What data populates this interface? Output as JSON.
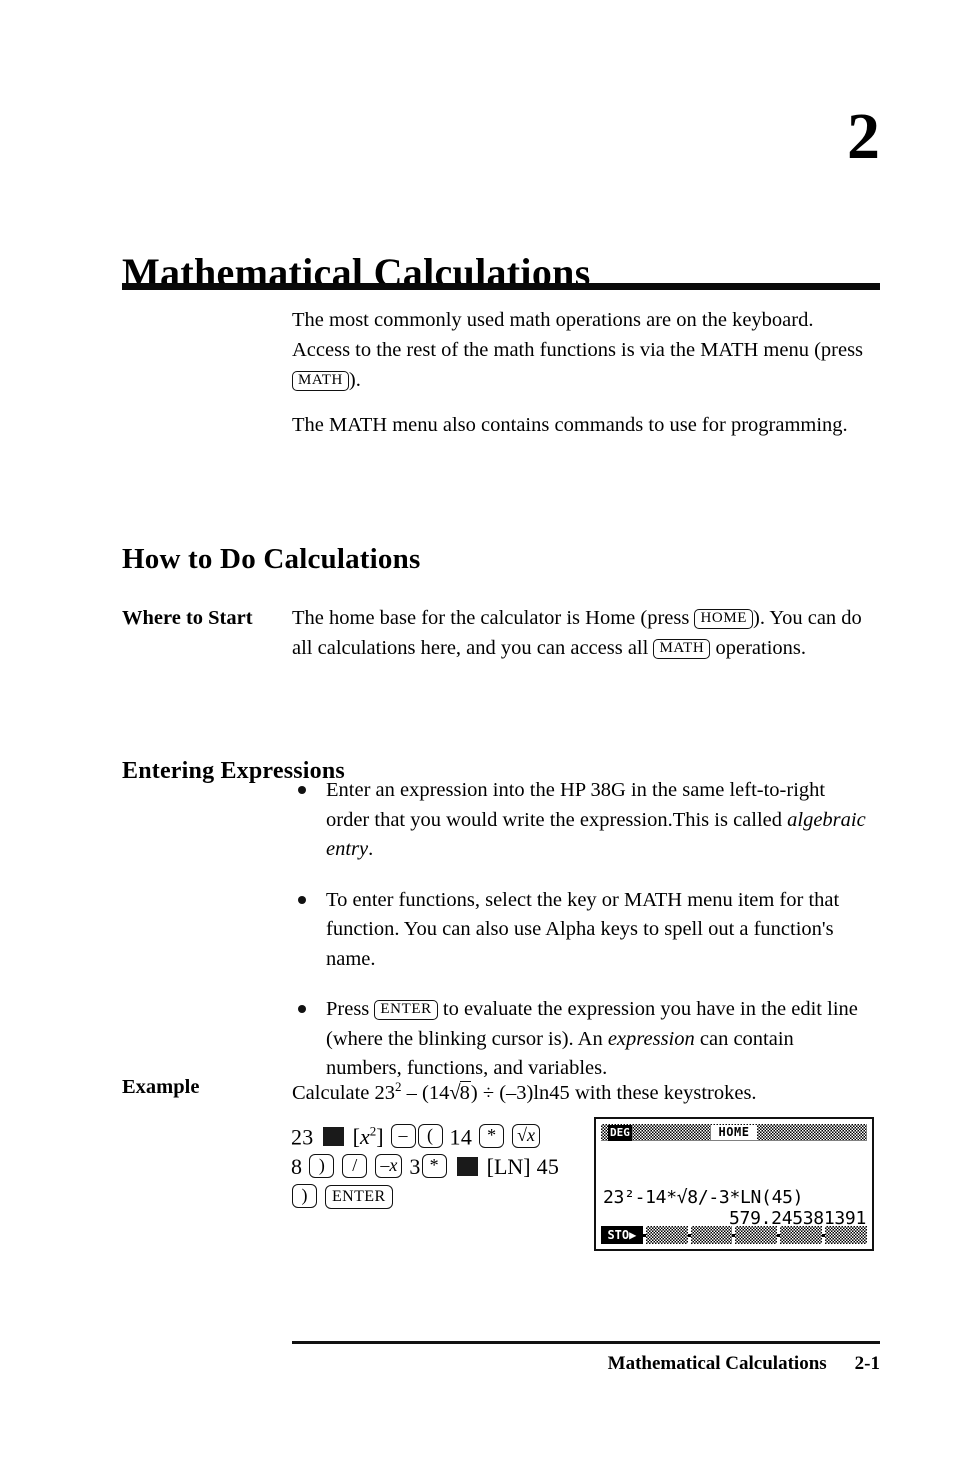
{
  "chapter": {
    "number": "2",
    "title": "Mathematical Calculations"
  },
  "intro": {
    "paragraph1_part1": "The most commonly used math operations are on the keyboard. Access to the rest of the math functions is via the MATH menu (press ",
    "paragraph1_key": "MATH",
    "paragraph1_part2": ").",
    "paragraph2": "The MATH menu also contains commands to use for programming."
  },
  "sections": {
    "how_to_do_calculations": "How to Do Calculations",
    "entering_expressions": "Entering Expressions"
  },
  "where_to_start": {
    "label": "Where to Start",
    "text_part1": "The home base for the calculator is Home (press ",
    "key_home": "HOME",
    "text_part2": "). You can do all calculations here, and you can access all ",
    "key_math": "MATH",
    "text_part3": " operations."
  },
  "bullets": [
    {
      "text_part1": "Enter an expression into the HP 38G in the same left-to-right order that you would write the expression.This is called ",
      "italic": "algebraic entry",
      "text_part2": "."
    },
    {
      "text_part1": "To enter functions, select the key or MATH menu item for that function. You can also use Alpha keys to spell out a function's name.",
      "italic": "",
      "text_part2": ""
    },
    {
      "text_part1": "Press ",
      "key": "ENTER",
      "text_part2": " to evaluate the expression you have in the edit line (where the blinking cursor is). An ",
      "italic": "expression",
      "text_part3": " can contain numbers, functions, and variables."
    }
  ],
  "example": {
    "label": "Example",
    "lead": "Calculate ",
    "formula_base": "23",
    "formula_exponent": "2",
    "formula_mid": " – (14",
    "formula_radical_sign": "√",
    "formula_radicand": "8",
    "formula_tail": ") ÷ (–3)ln45",
    "trailing": " with these keystrokes."
  },
  "keystrokes": {
    "line1": [
      {
        "type": "text",
        "label": "23"
      },
      {
        "type": "shift",
        "label": "shift"
      },
      {
        "type": "plain",
        "label": "[x²]"
      },
      {
        "type": "key",
        "label": "–"
      },
      {
        "type": "key",
        "label": "("
      },
      {
        "type": "text",
        "label": "14"
      },
      {
        "type": "key",
        "label": "*"
      },
      {
        "type": "key",
        "label": "√x"
      }
    ],
    "line2": [
      {
        "type": "text",
        "label": "8"
      },
      {
        "type": "key",
        "label": ")"
      },
      {
        "type": "key",
        "label": "/"
      },
      {
        "type": "key",
        "label": "–x"
      },
      {
        "type": "text",
        "label": "3"
      },
      {
        "type": "key",
        "label": "*"
      },
      {
        "type": "shift",
        "label": "shift"
      },
      {
        "type": "plain",
        "label": "[LN]"
      },
      {
        "type": "text",
        "label": "45"
      }
    ],
    "line3": [
      {
        "type": "key",
        "label": ")"
      },
      {
        "type": "key",
        "label": "ENTER"
      }
    ]
  },
  "lcd": {
    "mode_indicator": "DEG",
    "view_name": "HOME",
    "expression": "23²-14*√8/-3*LN(45)",
    "result": "579.245381391",
    "softkeys": [
      "STO▶",
      "",
      "",
      "",
      "",
      ""
    ]
  },
  "footer": {
    "title": "Mathematical Calculations",
    "page": "2-1"
  }
}
